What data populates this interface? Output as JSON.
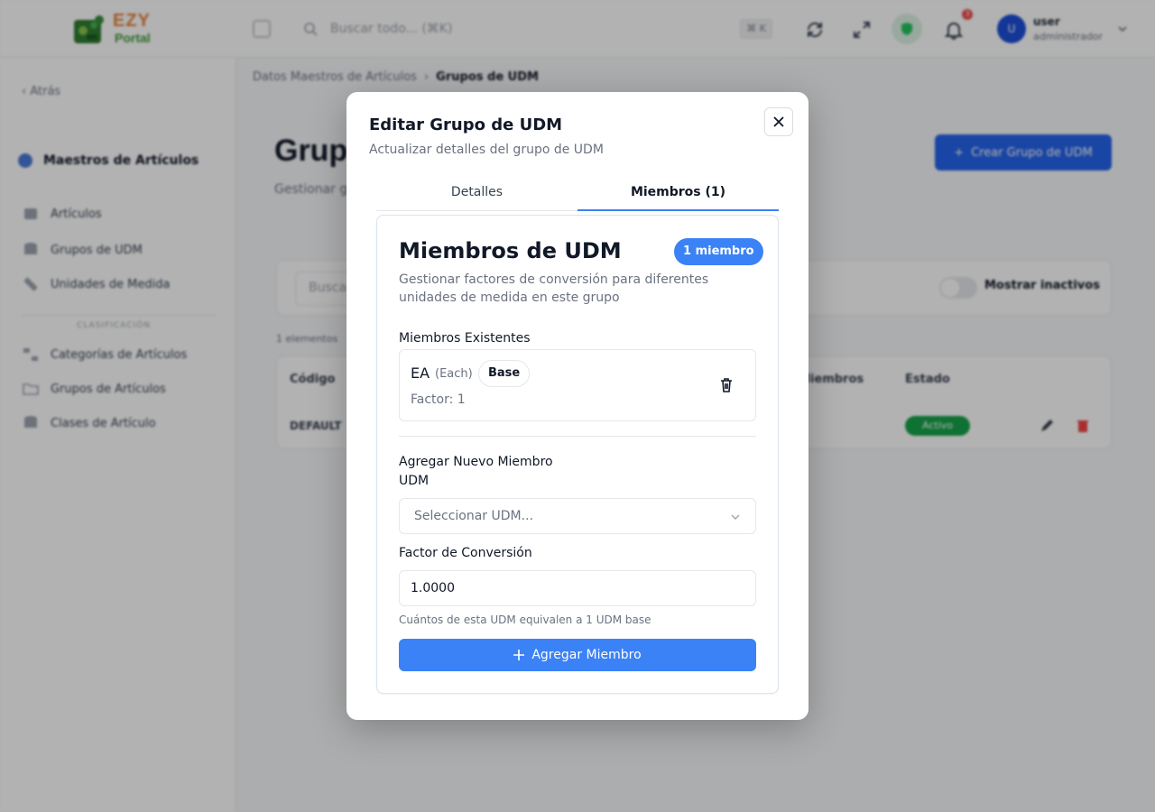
{
  "header": {
    "logo_top": "EZY",
    "logo_bottom": "Portal",
    "search_placeholder": "Buscar todo... (⌘K)",
    "search_kbd": "⌘ K",
    "notification_count": "3",
    "avatar_initial": "U",
    "user_name": "user",
    "user_role": "administrador"
  },
  "sidebar": {
    "back": "Atrás",
    "module_title": "Maestros de Artículos",
    "items_top": [
      {
        "label": "Artículos",
        "icon": "box-icon"
      },
      {
        "label": "Grupos de UDM",
        "icon": "database-icon"
      },
      {
        "label": "Unidades de Medida",
        "icon": "ruler-icon"
      }
    ],
    "section_label": "CLASIFICACIÓN",
    "items_bottom": [
      {
        "label": "Categorías de Artículos",
        "icon": "tree-icon"
      },
      {
        "label": "Grupos de Artículos",
        "icon": "folder-icon"
      },
      {
        "label": "Clases de Artículo",
        "icon": "layers-icon"
      }
    ]
  },
  "page": {
    "breadcrumb_parent": "Datos Maestros de Artículos",
    "breadcrumb_current": "Grupos de UDM",
    "title": "Grupos de UDM",
    "subtitle": "Gestionar grupos de unidades de medida",
    "create_button": "Crear Grupo de UDM",
    "filter_search_placeholder": "Buscar...",
    "show_inactive": "Mostrar inactivos",
    "count_text": "1 elementos",
    "columns": {
      "code": "Código",
      "members": "Miembros",
      "status": "Estado"
    },
    "row": {
      "code": "DEFAULT",
      "status": "Activo"
    }
  },
  "modal": {
    "title": "Editar Grupo de UDM",
    "description": "Actualizar detalles del grupo de UDM",
    "tabs": [
      {
        "label": "Detalles",
        "active": false
      },
      {
        "label": "Miembros (1)",
        "active": true
      }
    ],
    "card": {
      "title": "Miembros de UDM",
      "badge": "1 miembro",
      "description": "Gestionar factores de conversión para diferentes unidades de medida en este grupo",
      "existing_label": "Miembros Existentes",
      "member": {
        "code": "EA",
        "name": "(Each)",
        "base_label": "Base",
        "factor": "Factor: 1"
      },
      "add_label": "Agregar Nuevo Miembro",
      "uom_label": "UDM",
      "uom_placeholder": "Seleccionar UDM...",
      "factor_label": "Factor de Conversión",
      "factor_value": "1.0000",
      "hint": "Cuántos de esta UDM equivalen a 1 UDM base",
      "add_button": "Agregar Miembro"
    }
  },
  "colors": {
    "accent": "#3b82f6",
    "primary_button": "#2563eb",
    "success": "#16a34a",
    "danger": "#ef4444",
    "overlay": "rgba(0,0,0,0.30)"
  }
}
